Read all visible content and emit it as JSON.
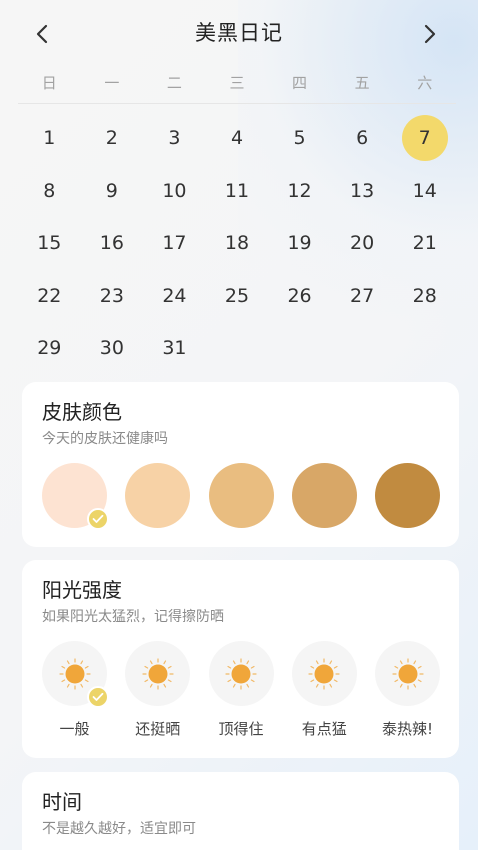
{
  "header": {
    "title": "美黑日记",
    "prev_icon": "chevron-left-icon",
    "next_icon": "chevron-right-icon"
  },
  "weekdays": [
    "日",
    "一",
    "二",
    "三",
    "四",
    "五",
    "六"
  ],
  "calendar": {
    "first_weekday_index": 0,
    "days": [
      "1",
      "2",
      "3",
      "4",
      "5",
      "6",
      "7",
      "8",
      "9",
      "10",
      "11",
      "12",
      "13",
      "14",
      "15",
      "16",
      "17",
      "18",
      "19",
      "20",
      "21",
      "22",
      "23",
      "24",
      "25",
      "26",
      "27",
      "28",
      "29",
      "30",
      "31"
    ],
    "selected_day": "7",
    "selected_color": "#f3d96b"
  },
  "skin": {
    "title": "皮肤颜色",
    "subtitle": "今天的皮肤还健康吗",
    "swatches": [
      {
        "color": "#fde3d2",
        "selected": true
      },
      {
        "color": "#f7d2a6",
        "selected": false
      },
      {
        "color": "#e9bd80",
        "selected": false
      },
      {
        "color": "#d8a767",
        "selected": false
      },
      {
        "color": "#c18b40",
        "selected": false
      }
    ]
  },
  "sun": {
    "title": "阳光强度",
    "subtitle": "如果阳光太猛烈，记得擦防晒",
    "icon": "sun-icon",
    "sun_color": "#f0a63a",
    "levels": [
      {
        "label": "一般",
        "selected": true
      },
      {
        "label": "还挺晒",
        "selected": false
      },
      {
        "label": "顶得住",
        "selected": false
      },
      {
        "label": "有点猛",
        "selected": false
      },
      {
        "label": "泰热辣!",
        "selected": false
      }
    ]
  },
  "time": {
    "title": "时间",
    "subtitle": "不是越久越好，适宜即可"
  },
  "colors": {
    "accent": "#ecd468",
    "card_bg": "#ffffff"
  }
}
